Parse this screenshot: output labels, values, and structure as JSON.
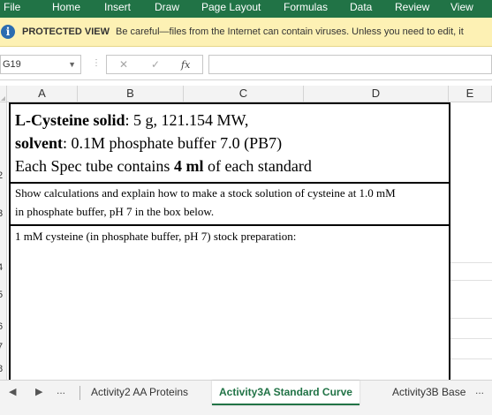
{
  "ribbon": {
    "tabs": [
      "File",
      "Home",
      "Insert",
      "Draw",
      "Page Layout",
      "Formulas",
      "Data",
      "Review",
      "View"
    ]
  },
  "protected_view": {
    "title": "PROTECTED VIEW",
    "message": "Be careful—files from the Internet can contain viruses. Unless you need to edit, it"
  },
  "formula_bar": {
    "name_box": "G19",
    "fx_label": "fx",
    "formula": ""
  },
  "columns": [
    "A",
    "B",
    "C",
    "D",
    "E"
  ],
  "rows": [
    "2",
    "3",
    "4",
    "5",
    "6",
    "7",
    "8"
  ],
  "content": {
    "line1_bold": "L-Cysteine solid",
    "line1_rest": ": 5 g, 121.154 MW,",
    "line2_bold": "solvent",
    "line2_rest": ": 0.1M phosphate buffer 7.0 (PB7)",
    "line3_start": "Each Spec tube contains ",
    "line3_bold": "4 ml",
    "line3_end": " of each standard",
    "instructions_1": "Show calculations and explain how to make a stock solution of cysteine at 1.0 mM",
    "instructions_2": "in phosphate buffer, pH 7 in the box below.",
    "stock_prep": "1 mM cysteine (in phosphate buffer, pH 7) stock preparation:"
  },
  "sheet_tabs": {
    "more": "...",
    "tabs": [
      "Activity2 AA Proteins",
      "Activity3A Standard Curve",
      "Activity3B Base"
    ],
    "active": "Activity3A Standard Curve",
    "more_right": "..."
  },
  "colors": {
    "ribbon": "#217346",
    "protected_bar": "#fdf1b4",
    "active_tab": "#217346"
  }
}
